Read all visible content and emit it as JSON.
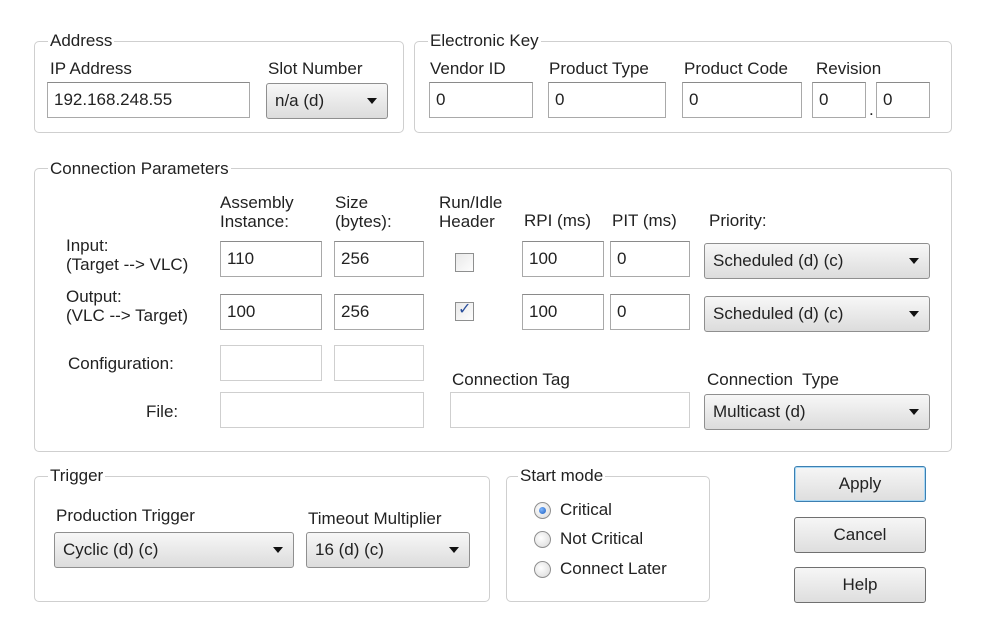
{
  "address": {
    "group_label": "Address",
    "ip_label": "IP Address",
    "ip_value": "192.168.248.55",
    "slot_label": "Slot Number",
    "slot_value": "n/a (d)"
  },
  "electronic_key": {
    "group_label": "Electronic Key",
    "vendor_label": "Vendor ID",
    "vendor_value": "0",
    "product_type_label": "Product Type",
    "product_type_value": "0",
    "product_code_label": "Product Code",
    "product_code_value": "0",
    "revision_label": "Revision",
    "revision_major": "0",
    "revision_sep": ".",
    "revision_minor": "0"
  },
  "connection": {
    "group_label": "Connection Parameters",
    "headers": {
      "assembly": "Assembly\nInstance:",
      "size": "Size\n(bytes):",
      "runidle": "Run/Idle\nHeader",
      "rpi": "RPI (ms)",
      "pit": "PIT (ms)",
      "priority": "Priority:"
    },
    "input": {
      "label": "Input:\n(Target --> VLC)",
      "assembly": "110",
      "size": "256",
      "runidle_checked": false,
      "rpi": "100",
      "pit": "0",
      "priority": "Scheduled (d) (c)"
    },
    "output": {
      "label": "Output:\n(VLC --> Target)",
      "assembly": "100",
      "size": "256",
      "runidle_checked": true,
      "rpi": "100",
      "pit": "0",
      "priority": "Scheduled (d) (c)"
    },
    "configuration_label": "Configuration:",
    "file_label": "File:",
    "connection_tag_label": "Connection Tag",
    "connection_type_label": "Connection  Type",
    "connection_type_value": "Multicast (d)"
  },
  "trigger": {
    "group_label": "Trigger",
    "production_label": "Production Trigger",
    "production_value": "Cyclic (d) (c)",
    "timeout_label": "Timeout Multiplier",
    "timeout_value": "16 (d) (c)"
  },
  "start_mode": {
    "group_label": "Start mode",
    "options": [
      "Critical",
      "Not Critical",
      "Connect Later"
    ],
    "selected": "Critical"
  },
  "buttons": {
    "apply": "Apply",
    "cancel": "Cancel",
    "help": "Help"
  }
}
